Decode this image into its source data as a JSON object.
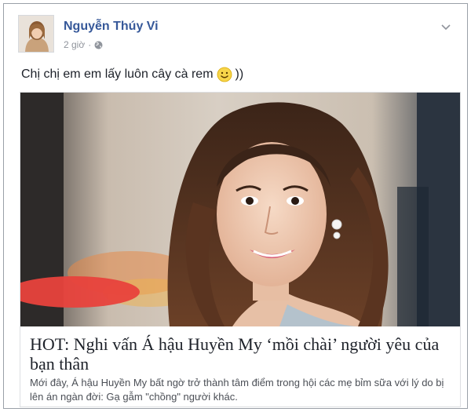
{
  "post": {
    "author": "Nguyễn Thúy Vi",
    "time": "2 giờ",
    "separator": "·",
    "text": "Chị chị em em lấy luôn cây cà rem",
    "text_suffix": "))",
    "privacy_icon": "globe-icon",
    "menu_icon": "chevron-down-icon",
    "emoji": "smiley-emoji"
  },
  "link": {
    "headline": "HOT: Nghi vấn Á hậu Huyền My ‘mồi chài’ người yêu của bạn thân",
    "description": "Mới đây, Á hậu Huyền My bất ngờ trở thành tâm điểm trong hội các mẹ bỉm sữa với lý do bị lên án ngàn đời: Gạ gẫm \"chồng\" người khác."
  },
  "colors": {
    "author_name": "#365899",
    "meta_text": "#90949c",
    "body_text": "#1d2129",
    "redaction": "#e8423c",
    "border": "#dddfe2"
  }
}
